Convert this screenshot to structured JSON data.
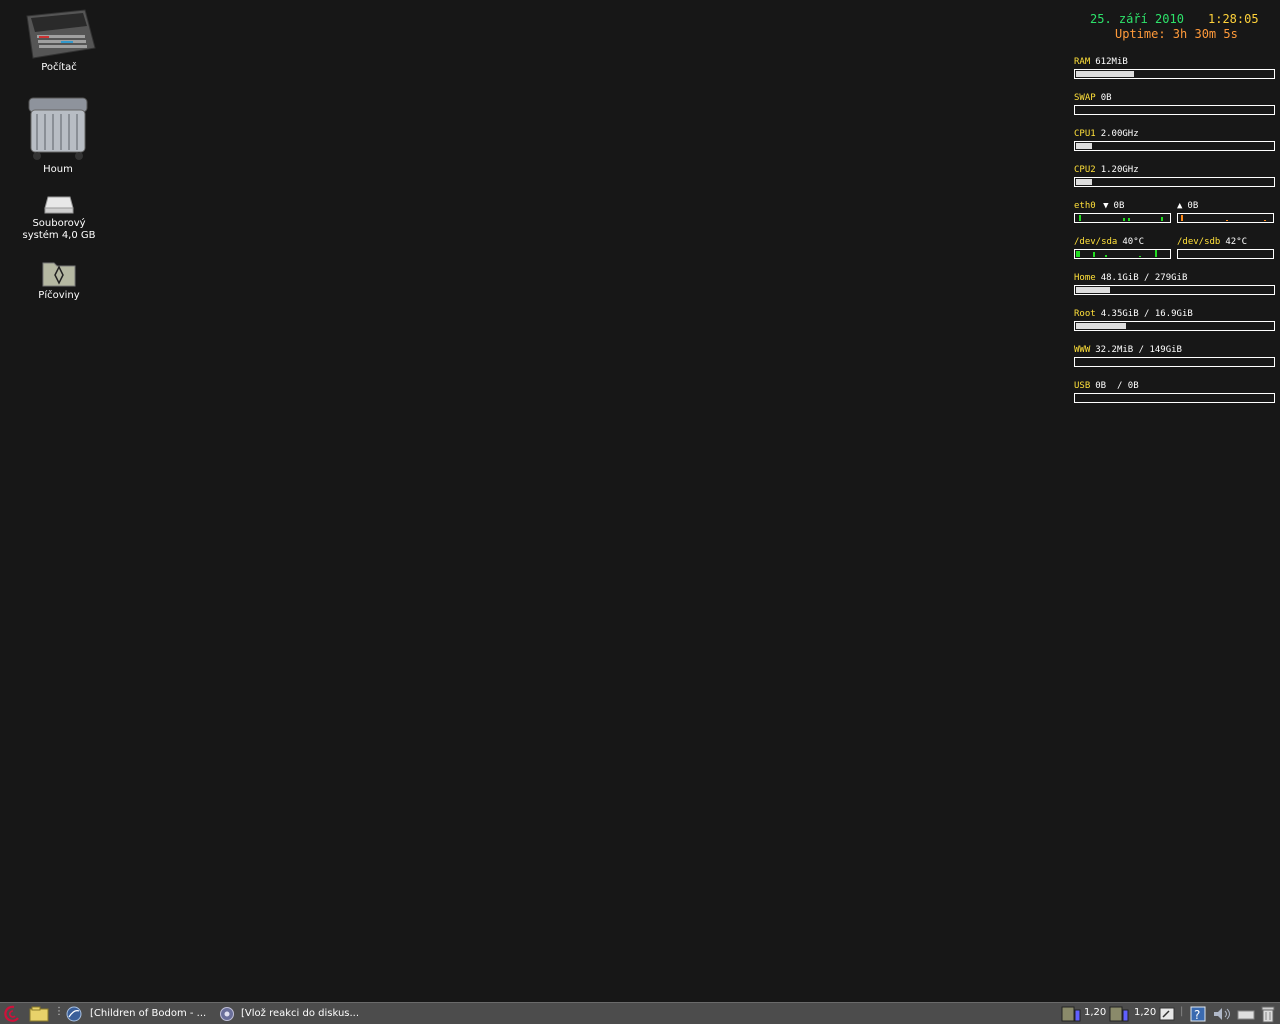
{
  "desktop": {
    "icons": [
      {
        "label": "Počítač"
      },
      {
        "label": "Houm"
      },
      {
        "label_line1": "Souborový",
        "label_line2": "systém 4,0 GB"
      },
      {
        "label": "Píčoviny"
      }
    ]
  },
  "conky": {
    "date": "25. září 2010",
    "time": "1:28:05",
    "uptime": "Uptime: 3h 30m 5s",
    "ram": {
      "label": "RAM",
      "value": "612MiB",
      "fill_percent": 29
    },
    "swap": {
      "label": "SWAP",
      "value": "0B",
      "fill_percent": 0
    },
    "cpu1": {
      "label": "CPU1",
      "value": "2.00GHz",
      "fill_percent": 8
    },
    "cpu2": {
      "label": "CPU2",
      "value": "1.20GHz",
      "fill_percent": 8
    },
    "eth0": {
      "label": "eth0",
      "down_arrow": "▼",
      "down_value": "0B",
      "up_arrow": "▲",
      "up_value": "0B"
    },
    "sda": {
      "label": "/dev/sda",
      "value": "40°C"
    },
    "sdb": {
      "label": "/dev/sdb",
      "value": "42°C"
    },
    "home": {
      "label": "Home",
      "value": "48.1GiB / 279GiB",
      "fill_percent": 17
    },
    "root": {
      "label": "Root",
      "value": "4.35GiB / 16.9GiB",
      "fill_percent": 25
    },
    "www": {
      "label": "WWW",
      "value": "32.2MiB / 149GiB",
      "fill_percent": 0
    },
    "usb": {
      "label": "USB",
      "value": "0B  / 0B",
      "fill_percent": 0
    }
  },
  "taskbar": {
    "tasks": [
      {
        "label": "[Children of Bodom - ..."
      },
      {
        "label": "[Vlož reakci do diskus..."
      }
    ],
    "tray": {
      "cpu1_freq": "1,20",
      "cpu2_freq": "1,20"
    }
  },
  "colors": {
    "desktop_bg": "#171717",
    "label_yellow": "#ffe03a",
    "date_green": "#2de26a",
    "time_yellow": "#ffd23a",
    "uptime_orange": "#ff9a3a",
    "graph_green": "#22dd22",
    "graph_orange": "#ff8a1a",
    "taskbar_bg": "#4c4c4c"
  }
}
